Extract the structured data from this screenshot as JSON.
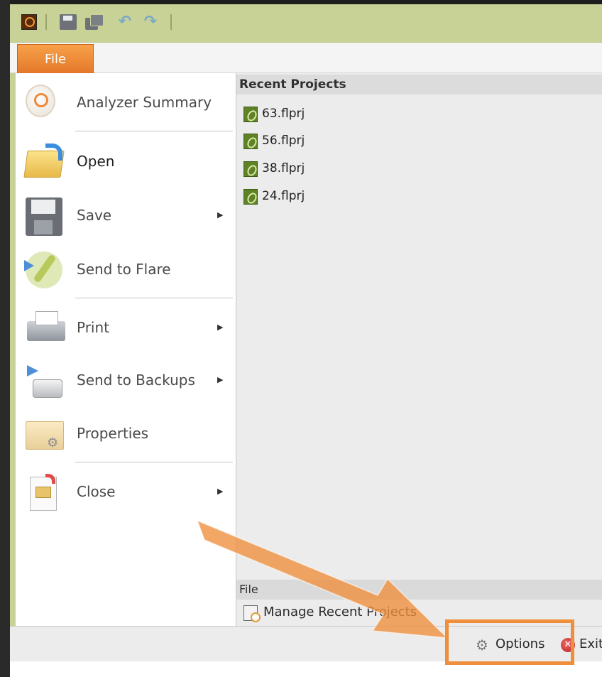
{
  "file_tab": "File",
  "menu": {
    "items": [
      {
        "label": "Analyzer Summary",
        "icon": "analyzer-summary-icon"
      },
      {
        "label": "Open",
        "icon": "open-folder-icon"
      },
      {
        "label": "Save",
        "icon": "save-disk-icon",
        "submenu": "▶"
      },
      {
        "label": "Send to Flare",
        "icon": "send-to-flare-icon"
      },
      {
        "label": "Print",
        "icon": "printer-icon",
        "submenu": "▶"
      },
      {
        "label": "Send to Backups",
        "icon": "send-to-backups-icon",
        "submenu": "▶"
      },
      {
        "label": "Properties",
        "icon": "properties-folder-icon"
      },
      {
        "label": "Close",
        "icon": "close-document-icon",
        "submenu": "▶"
      }
    ]
  },
  "recent": {
    "header": "Recent Projects",
    "items": [
      "63.flprj",
      "56.flprj",
      "38.flprj",
      "24.flprj"
    ]
  },
  "file_section": {
    "header": "File",
    "manage_label": "Manage Recent Projects"
  },
  "bottom": {
    "options_label": "Options",
    "exit_label": "Exit",
    "exit_symbol": "✕"
  },
  "colors": {
    "accent_green": "#c9d296",
    "file_tab_orange": "#e4782a",
    "highlight_orange": "#ef8e3b"
  }
}
